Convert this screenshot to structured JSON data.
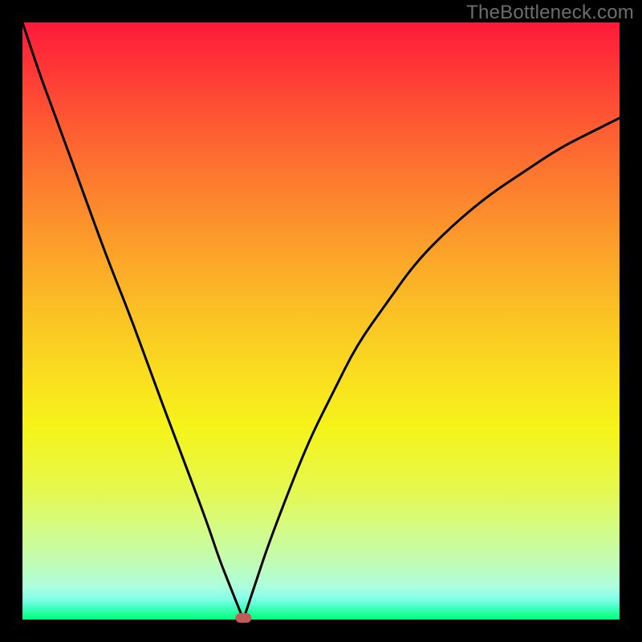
{
  "watermark": "TheBottleneck.com",
  "colors": {
    "accent": "#c15a5a",
    "curve": "#000000",
    "frame_bg": "#000000"
  },
  "chart_data": {
    "type": "line",
    "title": "",
    "xlabel": "",
    "ylabel": "",
    "xlim": [
      0,
      100
    ],
    "ylim": [
      0,
      100
    ],
    "grid": false,
    "legend": null,
    "minimum_marker": {
      "x": 37,
      "y": 0
    },
    "x": [
      0,
      3,
      6,
      10,
      14,
      18,
      22,
      25,
      28,
      31,
      33,
      35,
      37,
      37,
      39,
      41,
      44,
      48,
      52,
      56,
      61,
      66,
      72,
      78,
      84,
      90,
      96,
      100
    ],
    "values": [
      100,
      91,
      83,
      72,
      61,
      51,
      40,
      32,
      24,
      16,
      10,
      5,
      0,
      0,
      6,
      12,
      20,
      30,
      38,
      46,
      53,
      60,
      66,
      71,
      75,
      79,
      82,
      84
    ]
  }
}
